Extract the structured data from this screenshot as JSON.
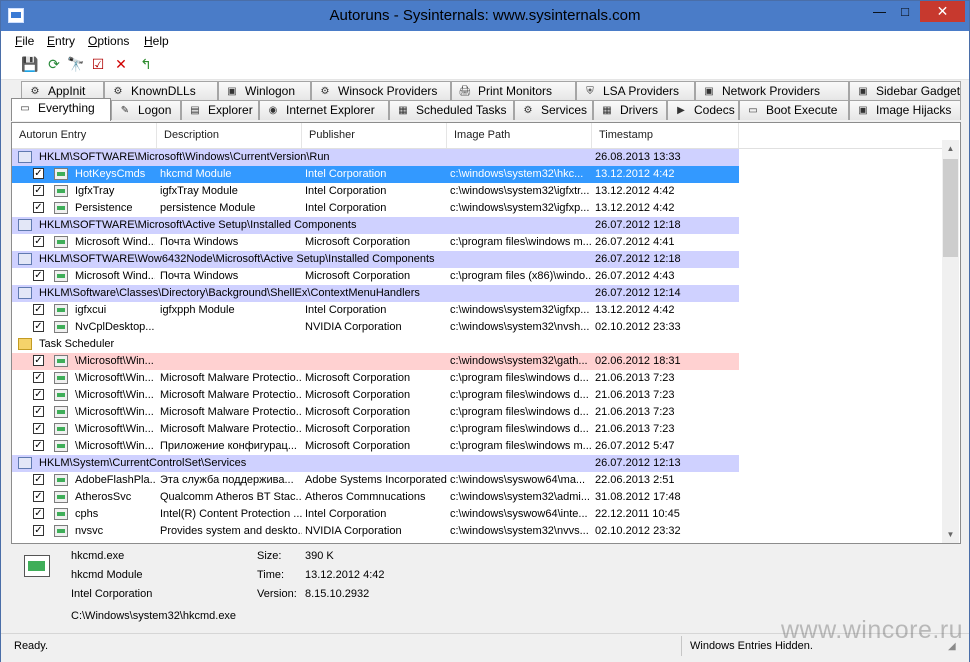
{
  "window": {
    "title": "Autoruns - Sysinternals: www.sysinternals.com",
    "min_glyph": "—",
    "max_glyph": "□",
    "close_glyph": "✕"
  },
  "menu": [
    {
      "first": "F",
      "rest": "ile"
    },
    {
      "first": "E",
      "rest": "ntry"
    },
    {
      "first": "O",
      "rest": "ptions"
    },
    {
      "first": "H",
      "rest": "elp"
    }
  ],
  "toolbar": [
    {
      "name": "save-icon",
      "glyph": "💾",
      "color": "#2a4fa3"
    },
    {
      "name": "refresh-icon",
      "glyph": "⟳",
      "color": "#2a8a3b"
    },
    {
      "name": "find-icon",
      "glyph": "🔭",
      "color": "#1f3fbf"
    },
    {
      "name": "properties-icon",
      "glyph": "☑",
      "color": "#b00000"
    },
    {
      "name": "delete-icon",
      "glyph": "✕",
      "color": "#d00000"
    },
    {
      "name": "jump-icon",
      "glyph": "↰",
      "color": "#2e8b2e"
    }
  ],
  "tabs_row1": [
    "AppInit",
    "KnownDLLs",
    "Winlogon",
    "Winsock Providers",
    "Print Monitors",
    "LSA Providers",
    "Network Providers",
    "Sidebar Gadgets"
  ],
  "tabs_row2": [
    "Everything",
    "Logon",
    "Explorer",
    "Internet Explorer",
    "Scheduled Tasks",
    "Services",
    "Drivers",
    "Codecs",
    "Boot Execute",
    "Image Hijacks"
  ],
  "columns": [
    "Autorun Entry",
    "Description",
    "Publisher",
    "Image Path",
    "Timestamp"
  ],
  "rows": [
    {
      "type": "group",
      "text": "HKLM\\SOFTWARE\\Microsoft\\Windows\\CurrentVersion\\Run",
      "time": "26.08.2013 13:33"
    },
    {
      "type": "entry",
      "state": "sel",
      "entry": "HotKeysCmds",
      "desc": "hkcmd Module",
      "pub": "Intel Corporation",
      "path": "c:\\windows\\system32\\hkc...",
      "time": "13.12.2012 4:42"
    },
    {
      "type": "entry",
      "entry": "IgfxTray",
      "desc": "igfxTray Module",
      "pub": "Intel Corporation",
      "path": "c:\\windows\\system32\\igfxtr...",
      "time": "13.12.2012 4:42"
    },
    {
      "type": "entry",
      "entry": "Persistence",
      "desc": "persistence Module",
      "pub": "Intel Corporation",
      "path": "c:\\windows\\system32\\igfxp...",
      "time": "13.12.2012 4:42"
    },
    {
      "type": "group",
      "text": "HKLM\\SOFTWARE\\Microsoft\\Active Setup\\Installed Components",
      "time": "26.07.2012 12:18"
    },
    {
      "type": "entry",
      "entry": "Microsoft Wind...",
      "desc": "Почта Windows",
      "pub": "Microsoft Corporation",
      "path": "c:\\program files\\windows m...",
      "time": "26.07.2012 4:41"
    },
    {
      "type": "group",
      "text": "HKLM\\SOFTWARE\\Wow6432Node\\Microsoft\\Active Setup\\Installed Components",
      "time": "26.07.2012 12:18"
    },
    {
      "type": "entry",
      "entry": "Microsoft Wind...",
      "desc": "Почта Windows",
      "pub": "Microsoft Corporation",
      "path": "c:\\program files (x86)\\windo...",
      "time": "26.07.2012 4:43"
    },
    {
      "type": "group",
      "text": "HKLM\\Software\\Classes\\Directory\\Background\\ShellEx\\ContextMenuHandlers",
      "time": "26.07.2012 12:14"
    },
    {
      "type": "entry",
      "entry": "igfxcui",
      "desc": "igfxpph Module",
      "pub": "Intel Corporation",
      "path": "c:\\windows\\system32\\igfxp...",
      "time": "13.12.2012 4:42"
    },
    {
      "type": "entry",
      "entry": "NvCplDesktop...",
      "desc": "",
      "pub": "NVIDIA Corporation",
      "path": "c:\\windows\\system32\\nvsh...",
      "time": "02.10.2012 23:33"
    },
    {
      "type": "group",
      "folder": true,
      "text": "Task Scheduler",
      "time": ""
    },
    {
      "type": "entry",
      "state": "warn",
      "entry": "\\Microsoft\\Win...",
      "desc": "",
      "pub": "",
      "path": "c:\\windows\\system32\\gath...",
      "time": "02.06.2012 18:31"
    },
    {
      "type": "entry",
      "entry": "\\Microsoft\\Win...",
      "desc": "Microsoft Malware Protectio...",
      "pub": "Microsoft Corporation",
      "path": "c:\\program files\\windows d...",
      "time": "21.06.2013 7:23"
    },
    {
      "type": "entry",
      "entry": "\\Microsoft\\Win...",
      "desc": "Microsoft Malware Protectio...",
      "pub": "Microsoft Corporation",
      "path": "c:\\program files\\windows d...",
      "time": "21.06.2013 7:23"
    },
    {
      "type": "entry",
      "entry": "\\Microsoft\\Win...",
      "desc": "Microsoft Malware Protectio...",
      "pub": "Microsoft Corporation",
      "path": "c:\\program files\\windows d...",
      "time": "21.06.2013 7:23"
    },
    {
      "type": "entry",
      "entry": "\\Microsoft\\Win...",
      "desc": "Microsoft Malware Protectio...",
      "pub": "Microsoft Corporation",
      "path": "c:\\program files\\windows d...",
      "time": "21.06.2013 7:23"
    },
    {
      "type": "entry",
      "entry": "\\Microsoft\\Win...",
      "desc": "Приложение конфигурац...",
      "pub": "Microsoft Corporation",
      "path": "c:\\program files\\windows m...",
      "time": "26.07.2012 5:47"
    },
    {
      "type": "group",
      "text": "HKLM\\System\\CurrentControlSet\\Services",
      "time": "26.07.2012 12:13"
    },
    {
      "type": "entry",
      "entry": "AdobeFlashPla...",
      "desc": "Эта служба поддержива...",
      "pub": "Adobe Systems Incorporated",
      "path": "c:\\windows\\syswow64\\ma...",
      "time": "22.06.2013 2:51"
    },
    {
      "type": "entry",
      "entry": "AtherosSvc",
      "desc": "Qualcomm Atheros BT Stac...",
      "pub": "Atheros Commnucations",
      "path": "c:\\windows\\system32\\admi...",
      "time": "31.08.2012 17:48"
    },
    {
      "type": "entry",
      "entry": "cphs",
      "desc": "Intel(R) Content Protection ...",
      "pub": "Intel Corporation",
      "path": "c:\\windows\\syswow64\\inte...",
      "time": "22.12.2011 10:45"
    },
    {
      "type": "entry",
      "entry": "nvsvc",
      "desc": "Provides system and deskto...",
      "pub": "NVIDIA Corporation",
      "path": "c:\\windows\\system32\\nvvs...",
      "time": "02.10.2012 23:32"
    }
  ],
  "details": {
    "file": "hkcmd.exe",
    "module": "hkcmd Module",
    "company": "Intel Corporation",
    "path": "C:\\Windows\\system32\\hkcmd.exe",
    "size_label": "Size:",
    "size": "390 K",
    "time_label": "Time:",
    "time": "13.12.2012 4:42",
    "version_label": "Version:",
    "version": "8.15.10.2932"
  },
  "status": {
    "left": "Ready.",
    "right": "Windows Entries Hidden."
  },
  "watermark": "www.wincore.ru"
}
